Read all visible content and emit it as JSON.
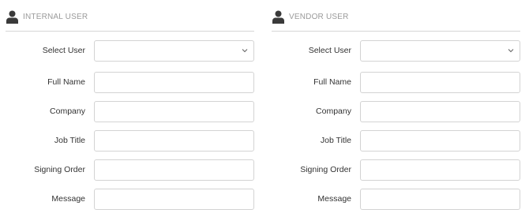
{
  "internal": {
    "title": "INTERNAL USER",
    "icon": "person-icon",
    "fields": {
      "select_user": {
        "label": "Select User",
        "value": ""
      },
      "full_name": {
        "label": "Full Name",
        "value": ""
      },
      "company": {
        "label": "Company",
        "value": ""
      },
      "job_title": {
        "label": "Job Title",
        "value": ""
      },
      "signing_order": {
        "label": "Signing Order",
        "value": ""
      },
      "message": {
        "label": "Message",
        "value": ""
      }
    }
  },
  "vendor": {
    "title": "VENDOR USER",
    "icon": "person-icon",
    "fields": {
      "select_user": {
        "label": "Select User",
        "value": ""
      },
      "full_name": {
        "label": "Full Name",
        "value": ""
      },
      "company": {
        "label": "Company",
        "value": ""
      },
      "job_title": {
        "label": "Job Title",
        "value": ""
      },
      "signing_order": {
        "label": "Signing Order",
        "value": ""
      },
      "message": {
        "label": "Message",
        "value": ""
      }
    }
  },
  "colors": {
    "header_text": "#9a9a9a",
    "border": "#d3d3d3",
    "icon": "#3a3a3a"
  }
}
